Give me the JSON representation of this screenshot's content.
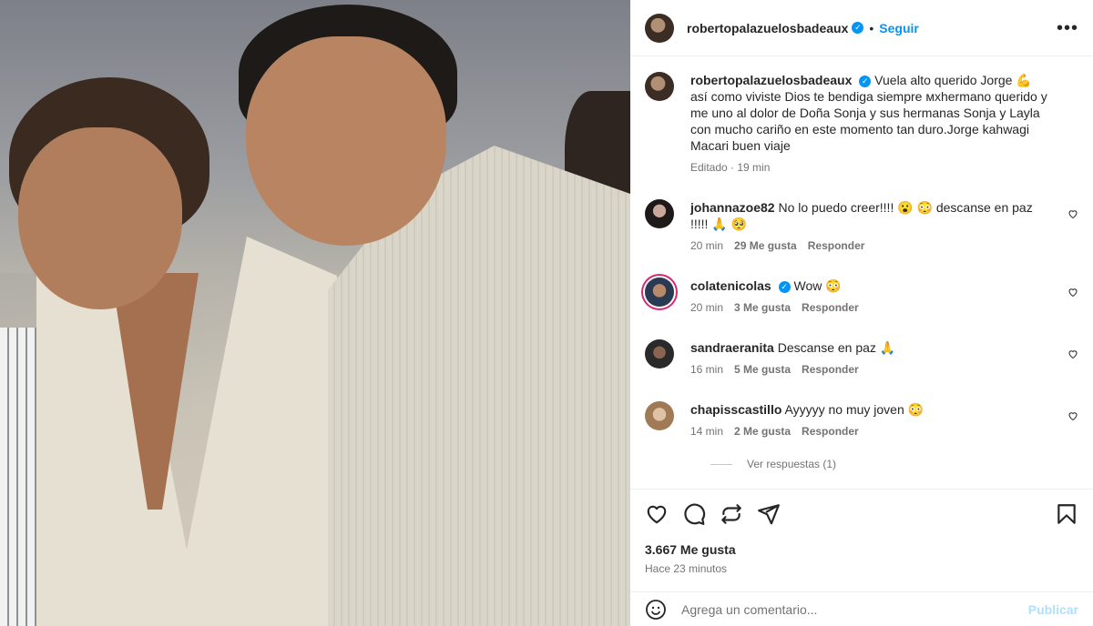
{
  "post": {
    "author": "robertopalazuelosbadeaux",
    "follow_label": "Seguir",
    "dot": "•",
    "more": "•••",
    "verified_mark": "✓"
  },
  "caption": {
    "author": "robertopalazuelosbadeaux",
    "text": "Vuela alto querido Jorge 💪 así como viviste Dios te bendiga siempre мхhermano querido y me uno al dolor de Doña Sonja y sus hermanas Sonja y Layla con mucho cariño en este momento tan duro.Jorge kahwagi Macari buen viaje",
    "meta": "Editado · 19 min"
  },
  "comments": [
    {
      "user": "johannazoe82",
      "text": "No lo puedo creer!!!! 😮 😳  descanse en paz !!!!! 🙏 🥺",
      "time": "20 min",
      "likes": "29 Me gusta",
      "reply": "Responder"
    },
    {
      "user": "colatenicolas",
      "text": "Wow 😳",
      "time": "20 min",
      "likes": "3 Me gusta",
      "reply": "Responder"
    },
    {
      "user": "sandraeranita",
      "text": "Descanse en paz 🙏",
      "time": "16 min",
      "likes": "5 Me gusta",
      "reply": "Responder"
    },
    {
      "user": "chapisscastillo",
      "text": "Ayyyyy no muy joven 😳",
      "time": "14 min",
      "likes": "2 Me gusta",
      "reply": "Responder"
    }
  ],
  "view_replies": "Ver respuestas (1)",
  "likes_count": "3.667 Me gusta",
  "posted_ago": "Hace 23 minutos",
  "composer": {
    "placeholder": "Agrega un comentario...",
    "publish_label": "Publicar"
  },
  "colors": {
    "accent": "#0095f6",
    "publish_disabled": "#b2dffc",
    "secondary_text": "#737373"
  },
  "icons": [
    "heart-icon",
    "comment-icon",
    "share-icon",
    "send-icon",
    "bookmark-icon",
    "emoji-icon",
    "more-icon",
    "verified-icon"
  ]
}
